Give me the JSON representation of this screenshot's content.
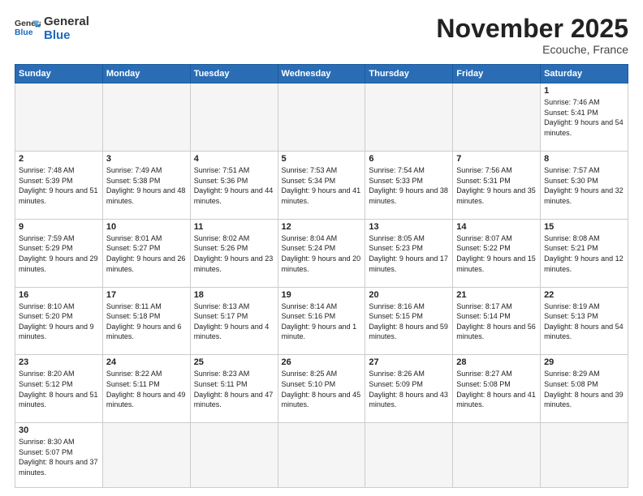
{
  "header": {
    "logo_general": "General",
    "logo_blue": "Blue",
    "month": "November 2025",
    "location": "Ecouche, France"
  },
  "weekdays": [
    "Sunday",
    "Monday",
    "Tuesday",
    "Wednesday",
    "Thursday",
    "Friday",
    "Saturday"
  ],
  "weeks": [
    [
      {
        "day": "",
        "info": ""
      },
      {
        "day": "",
        "info": ""
      },
      {
        "day": "",
        "info": ""
      },
      {
        "day": "",
        "info": ""
      },
      {
        "day": "",
        "info": ""
      },
      {
        "day": "",
        "info": ""
      },
      {
        "day": "1",
        "info": "Sunrise: 7:46 AM\nSunset: 5:41 PM\nDaylight: 9 hours\nand 54 minutes."
      }
    ],
    [
      {
        "day": "2",
        "info": "Sunrise: 7:48 AM\nSunset: 5:39 PM\nDaylight: 9 hours\nand 51 minutes."
      },
      {
        "day": "3",
        "info": "Sunrise: 7:49 AM\nSunset: 5:38 PM\nDaylight: 9 hours\nand 48 minutes."
      },
      {
        "day": "4",
        "info": "Sunrise: 7:51 AM\nSunset: 5:36 PM\nDaylight: 9 hours\nand 44 minutes."
      },
      {
        "day": "5",
        "info": "Sunrise: 7:53 AM\nSunset: 5:34 PM\nDaylight: 9 hours\nand 41 minutes."
      },
      {
        "day": "6",
        "info": "Sunrise: 7:54 AM\nSunset: 5:33 PM\nDaylight: 9 hours\nand 38 minutes."
      },
      {
        "day": "7",
        "info": "Sunrise: 7:56 AM\nSunset: 5:31 PM\nDaylight: 9 hours\nand 35 minutes."
      },
      {
        "day": "8",
        "info": "Sunrise: 7:57 AM\nSunset: 5:30 PM\nDaylight: 9 hours\nand 32 minutes."
      }
    ],
    [
      {
        "day": "9",
        "info": "Sunrise: 7:59 AM\nSunset: 5:29 PM\nDaylight: 9 hours\nand 29 minutes."
      },
      {
        "day": "10",
        "info": "Sunrise: 8:01 AM\nSunset: 5:27 PM\nDaylight: 9 hours\nand 26 minutes."
      },
      {
        "day": "11",
        "info": "Sunrise: 8:02 AM\nSunset: 5:26 PM\nDaylight: 9 hours\nand 23 minutes."
      },
      {
        "day": "12",
        "info": "Sunrise: 8:04 AM\nSunset: 5:24 PM\nDaylight: 9 hours\nand 20 minutes."
      },
      {
        "day": "13",
        "info": "Sunrise: 8:05 AM\nSunset: 5:23 PM\nDaylight: 9 hours\nand 17 minutes."
      },
      {
        "day": "14",
        "info": "Sunrise: 8:07 AM\nSunset: 5:22 PM\nDaylight: 9 hours\nand 15 minutes."
      },
      {
        "day": "15",
        "info": "Sunrise: 8:08 AM\nSunset: 5:21 PM\nDaylight: 9 hours\nand 12 minutes."
      }
    ],
    [
      {
        "day": "16",
        "info": "Sunrise: 8:10 AM\nSunset: 5:20 PM\nDaylight: 9 hours\nand 9 minutes."
      },
      {
        "day": "17",
        "info": "Sunrise: 8:11 AM\nSunset: 5:18 PM\nDaylight: 9 hours\nand 6 minutes."
      },
      {
        "day": "18",
        "info": "Sunrise: 8:13 AM\nSunset: 5:17 PM\nDaylight: 9 hours\nand 4 minutes."
      },
      {
        "day": "19",
        "info": "Sunrise: 8:14 AM\nSunset: 5:16 PM\nDaylight: 9 hours\nand 1 minute."
      },
      {
        "day": "20",
        "info": "Sunrise: 8:16 AM\nSunset: 5:15 PM\nDaylight: 8 hours\nand 59 minutes."
      },
      {
        "day": "21",
        "info": "Sunrise: 8:17 AM\nSunset: 5:14 PM\nDaylight: 8 hours\nand 56 minutes."
      },
      {
        "day": "22",
        "info": "Sunrise: 8:19 AM\nSunset: 5:13 PM\nDaylight: 8 hours\nand 54 minutes."
      }
    ],
    [
      {
        "day": "23",
        "info": "Sunrise: 8:20 AM\nSunset: 5:12 PM\nDaylight: 8 hours\nand 51 minutes."
      },
      {
        "day": "24",
        "info": "Sunrise: 8:22 AM\nSunset: 5:11 PM\nDaylight: 8 hours\nand 49 minutes."
      },
      {
        "day": "25",
        "info": "Sunrise: 8:23 AM\nSunset: 5:11 PM\nDaylight: 8 hours\nand 47 minutes."
      },
      {
        "day": "26",
        "info": "Sunrise: 8:25 AM\nSunset: 5:10 PM\nDaylight: 8 hours\nand 45 minutes."
      },
      {
        "day": "27",
        "info": "Sunrise: 8:26 AM\nSunset: 5:09 PM\nDaylight: 8 hours\nand 43 minutes."
      },
      {
        "day": "28",
        "info": "Sunrise: 8:27 AM\nSunset: 5:08 PM\nDaylight: 8 hours\nand 41 minutes."
      },
      {
        "day": "29",
        "info": "Sunrise: 8:29 AM\nSunset: 5:08 PM\nDaylight: 8 hours\nand 39 minutes."
      }
    ],
    [
      {
        "day": "30",
        "info": "Sunrise: 8:30 AM\nSunset: 5:07 PM\nDaylight: 8 hours\nand 37 minutes."
      },
      {
        "day": "",
        "info": ""
      },
      {
        "day": "",
        "info": ""
      },
      {
        "day": "",
        "info": ""
      },
      {
        "day": "",
        "info": ""
      },
      {
        "day": "",
        "info": ""
      },
      {
        "day": "",
        "info": ""
      }
    ]
  ]
}
